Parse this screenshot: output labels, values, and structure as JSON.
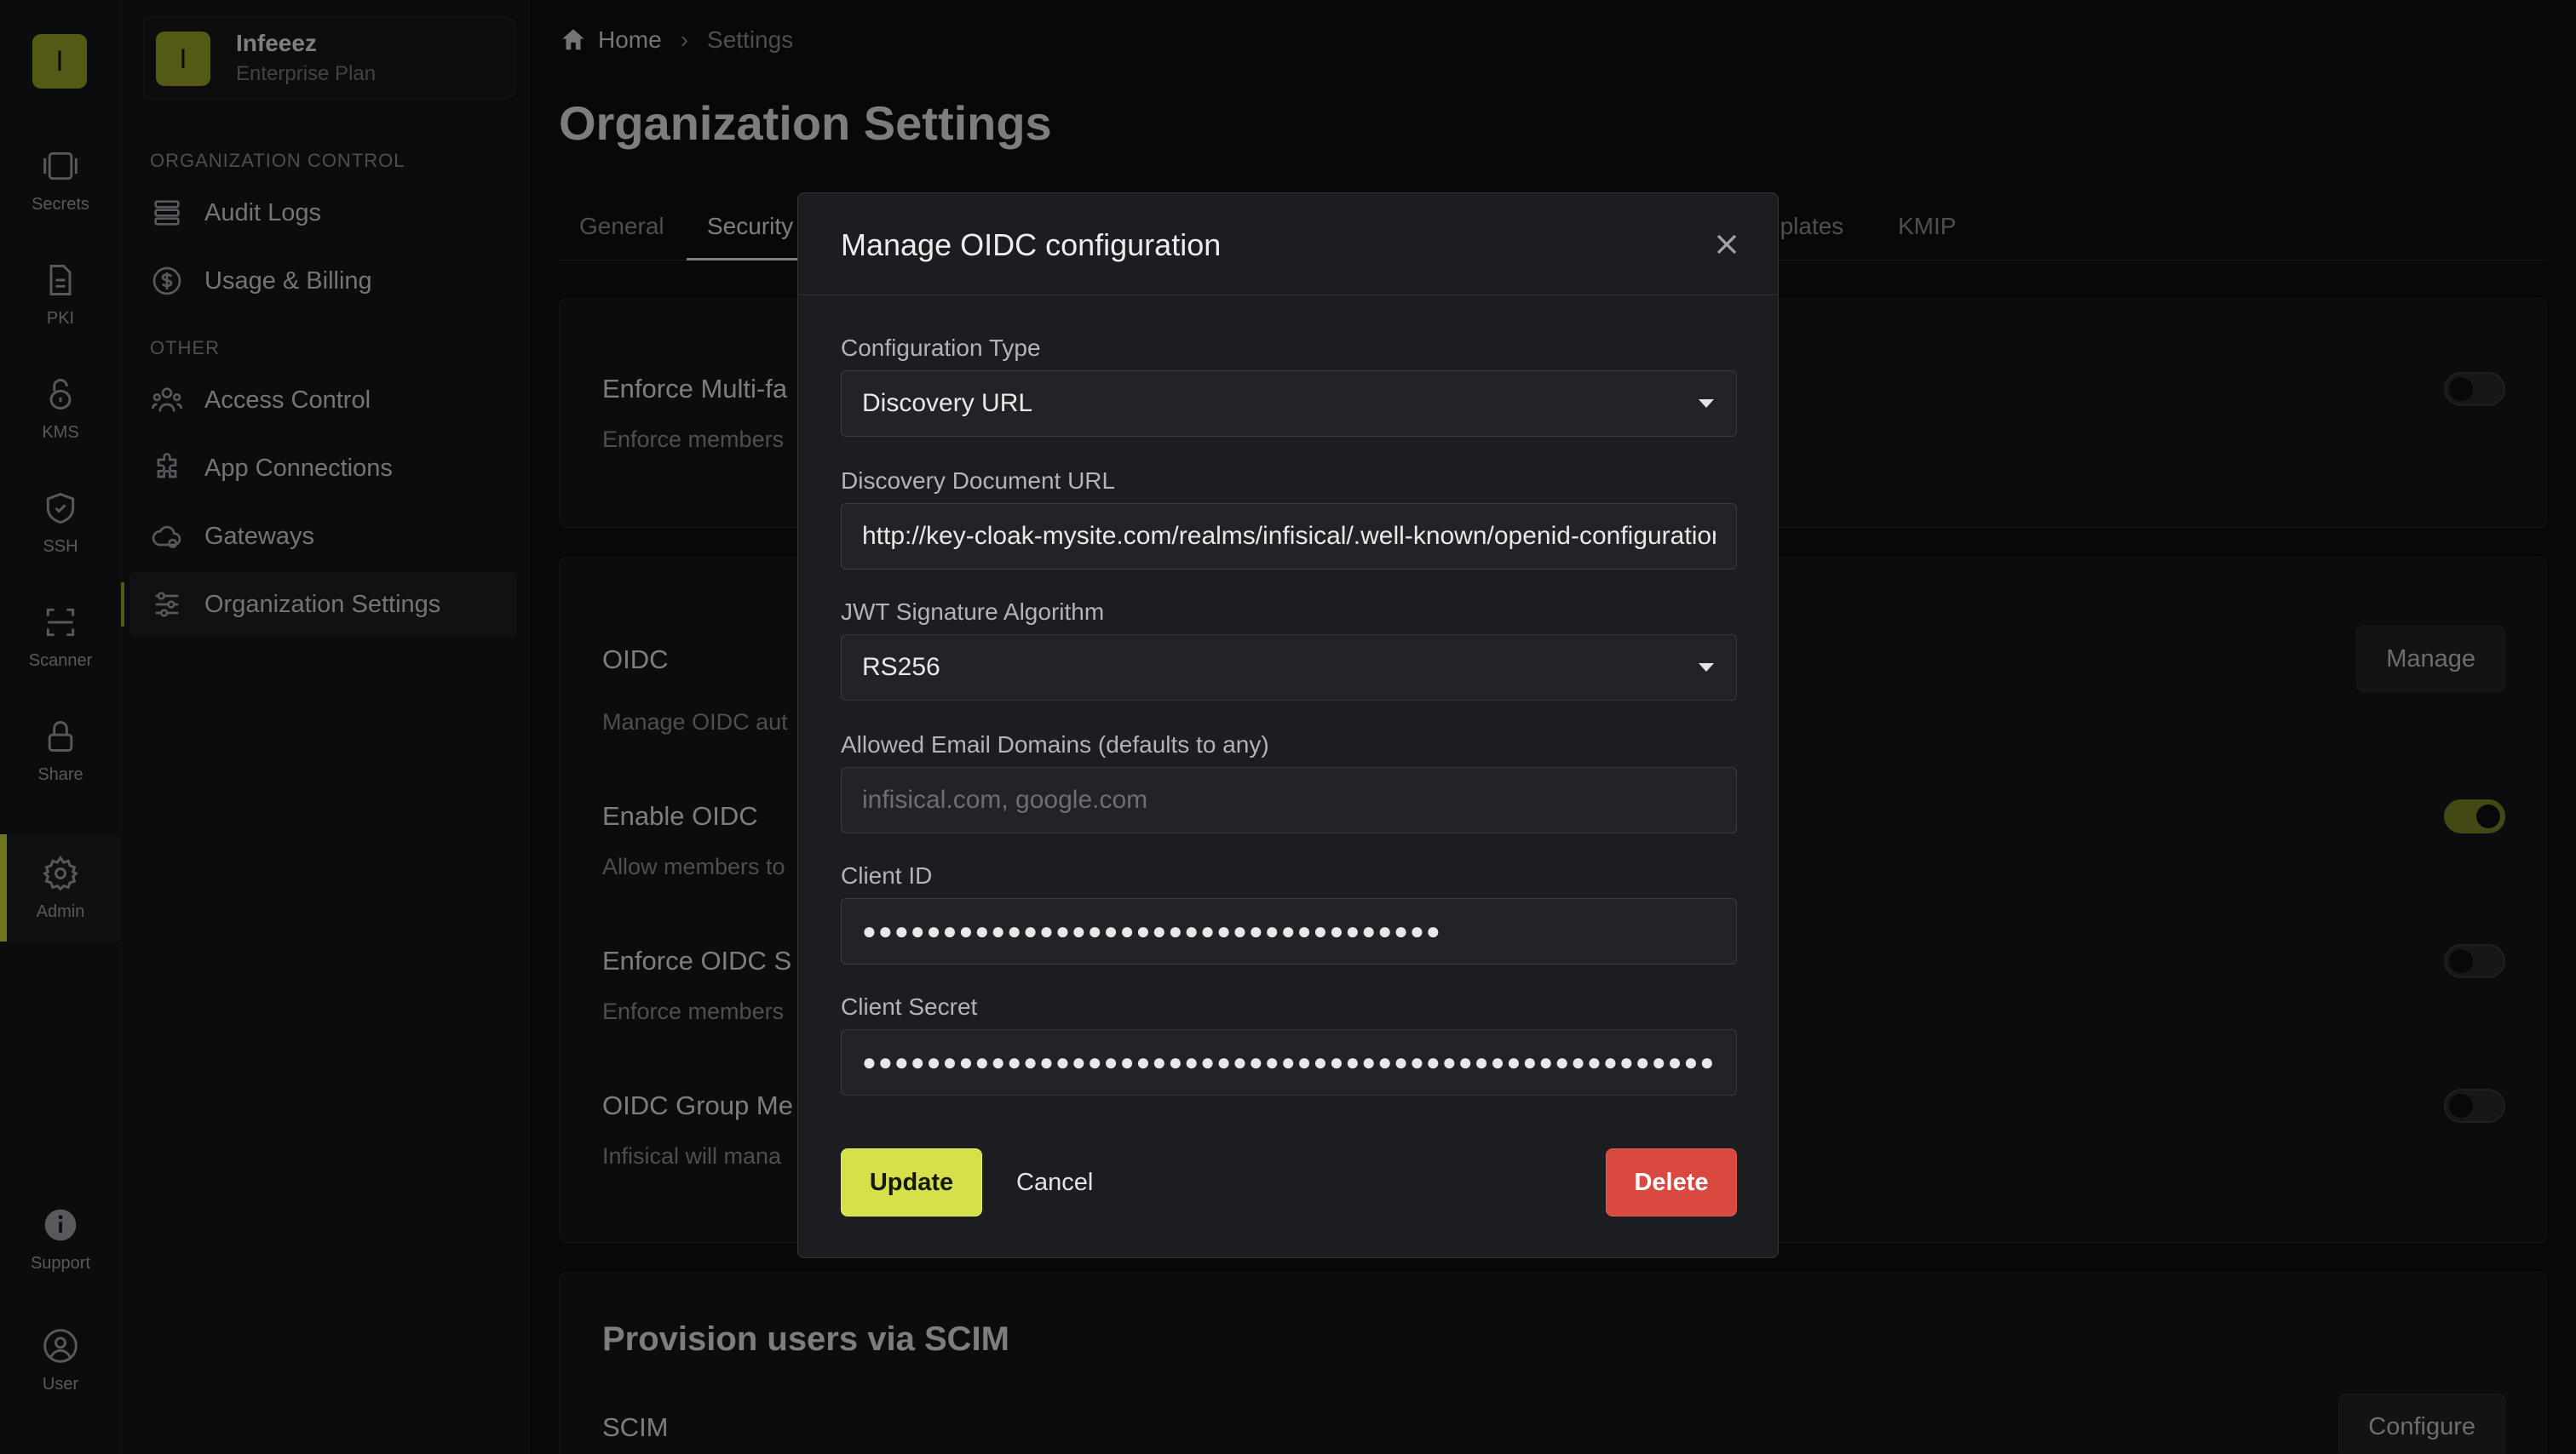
{
  "rail": {
    "logo": "I",
    "items": [
      {
        "label": "Secrets",
        "icon": "vault-icon"
      },
      {
        "label": "PKI",
        "icon": "document-icon"
      },
      {
        "label": "KMS",
        "icon": "lock-key-icon"
      },
      {
        "label": "SSH",
        "icon": "shield-icon"
      },
      {
        "label": "Scanner",
        "icon": "scan-icon"
      },
      {
        "label": "Share",
        "icon": "lock-icon"
      },
      {
        "label": "Admin",
        "icon": "gear-icon"
      },
      {
        "label": "Support",
        "icon": "info-icon"
      },
      {
        "label": "User",
        "icon": "user-icon"
      }
    ]
  },
  "sidebar": {
    "org_initial": "I",
    "org_name": "Infeeez",
    "org_plan": "Enterprise Plan",
    "section_org_control": "ORGANIZATION CONTROL",
    "section_other": "OTHER",
    "items": [
      {
        "label": "Audit Logs",
        "icon": "list-icon"
      },
      {
        "label": "Usage & Billing",
        "icon": "dollar-icon"
      },
      {
        "label": "Access Control",
        "icon": "users-icon"
      },
      {
        "label": "App Connections",
        "icon": "puzzle-icon"
      },
      {
        "label": "Gateways",
        "icon": "cloud-icon"
      },
      {
        "label": "Organization Settings",
        "icon": "sliders-icon"
      }
    ]
  },
  "breadcrumb": {
    "home": "Home",
    "current": "Settings"
  },
  "page": {
    "title": "Organization Settings",
    "tabs": [
      "General",
      "Security",
      "nplates",
      "KMIP"
    ]
  },
  "security": {
    "mfa_title": "Enforce Multi-fa",
    "mfa_desc": "Enforce members",
    "oidc_title": "OIDC",
    "oidc_desc": "Manage OIDC aut",
    "oidc_manage": "Manage",
    "enable_oidc_title": "Enable OIDC",
    "enable_oidc_desc": "Allow members to",
    "enforce_oidc_title": "Enforce OIDC S",
    "enforce_oidc_desc": "Enforce members",
    "group_title": "OIDC Group Me",
    "group_desc": "Infisical will mana",
    "scim_heading": "Provision users via SCIM",
    "scim_title": "SCIM",
    "scim_configure": "Configure"
  },
  "modal": {
    "title": "Manage OIDC configuration",
    "config_type_label": "Configuration Type",
    "config_type_value": "Discovery URL",
    "discovery_label": "Discovery Document URL",
    "discovery_value": "http://key-cloak-mysite.com/realms/infisical/.well-known/openid-configuration",
    "jwt_label": "JWT Signature Algorithm",
    "jwt_value": "RS256",
    "domains_label": "Allowed Email Domains (defaults to any)",
    "domains_placeholder": "infisical.com, google.com",
    "client_id_label": "Client ID",
    "client_id_value": "●●●●●●●●●●●●●●●●●●●●●●●●●●●●●●●●●●●●",
    "client_secret_label": "Client Secret",
    "client_secret_value": "●●●●●●●●●●●●●●●●●●●●●●●●●●●●●●●●●●●●●●●●●●●●●●●●●●●●●●●●●●●●●●●●",
    "update": "Update",
    "cancel": "Cancel",
    "delete": "Delete"
  },
  "colors": {
    "accent": "#d5e04a",
    "danger": "#d9493f",
    "background": "#0f1012"
  }
}
